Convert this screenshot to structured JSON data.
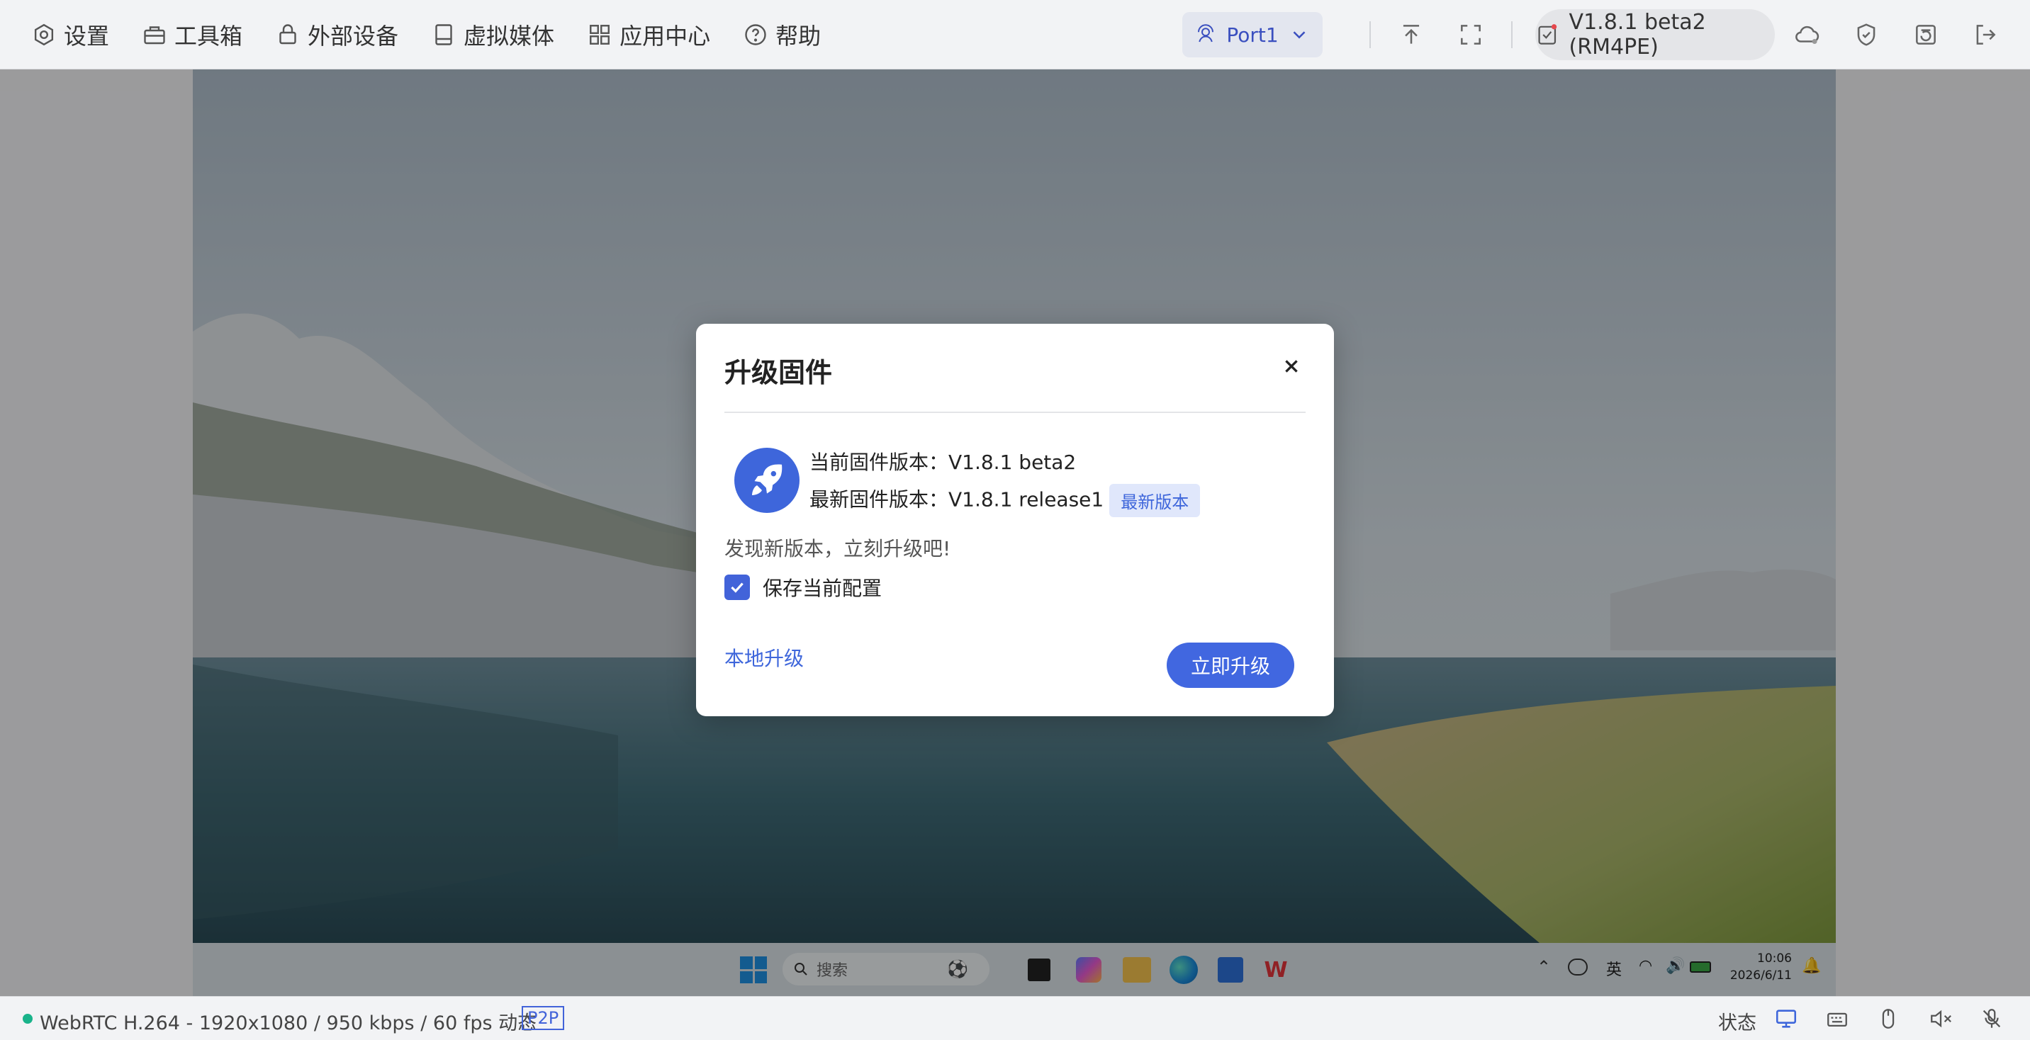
{
  "menu": {
    "items": [
      {
        "label": "设置",
        "icon": "gear-icon"
      },
      {
        "label": "工具箱",
        "icon": "toolbox-icon"
      },
      {
        "label": "外部设备",
        "icon": "lock-icon"
      },
      {
        "label": "虚拟媒体",
        "icon": "disk-icon"
      },
      {
        "label": "应用中心",
        "icon": "apps-icon"
      },
      {
        "label": "帮助",
        "icon": "help-icon"
      }
    ]
  },
  "toolbar": {
    "port_label": "Port1",
    "version_label": "V1.8.1 beta2 (RM4PE)"
  },
  "dialog": {
    "title": "升级固件",
    "current_version": "当前固件版本：V1.8.1 beta2",
    "latest_version": "最新固件版本：V1.8.1 release1",
    "latest_badge": "最新版本",
    "tip": "发现新版本，立刻升级吧!",
    "save_config_label": "保存当前配置",
    "save_config_checked": true,
    "local_upgrade": "本地升级",
    "upgrade_now": "立即升级"
  },
  "taskbar": {
    "search_placeholder": "搜索",
    "ime": "英",
    "time": "10:06",
    "date": "2026/6/11"
  },
  "status": {
    "stream_info": "WebRTC H.264 - 1920x1080 / 950 kbps / 60 fps 动态",
    "p2p_badge": "P2P",
    "status_label": "状态"
  },
  "colors": {
    "accent": "#4167e0",
    "connected": "#19b38a"
  }
}
